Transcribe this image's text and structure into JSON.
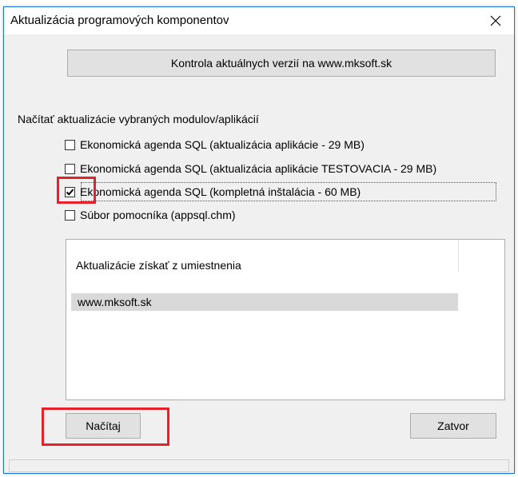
{
  "window": {
    "title": "Aktualizácia programových komponentov"
  },
  "check_versions_button": "Kontrola aktuálnych verzií na www.mksoft.sk",
  "modules_label": "Načítať aktualizácie vybraných modulov/aplikácií",
  "modules": [
    {
      "label": "Ekonomická agenda SQL (aktualizácia aplikácie - 29 MB)",
      "checked": false
    },
    {
      "label": "Ekonomická agenda SQL (aktualizácia aplikácie TESTOVACIA - 29 MB)",
      "checked": false
    },
    {
      "label": "Ekonomická agenda SQL (kompletná inštalácia - 60 MB)",
      "checked": true
    },
    {
      "label": "Súbor pomocníka (appsql.chm)",
      "checked": false
    }
  ],
  "source_list": {
    "header": "Aktualizácie získať z umiestnenia",
    "items": [
      "www.mksoft.sk"
    ]
  },
  "buttons": {
    "load": "Načítaj",
    "close": "Zatvor"
  },
  "colors": {
    "annotation": "#e8202a",
    "window_border": "#1e73d8"
  }
}
